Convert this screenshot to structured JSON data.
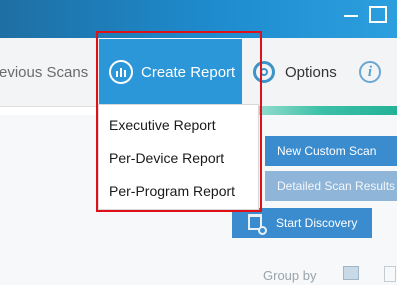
{
  "toolbar": {
    "previous_scans": "revious Scans",
    "create_report": "Create Report",
    "options": "Options",
    "info_glyph": "i"
  },
  "create_report_menu": {
    "items": [
      "Executive Report",
      "Per-Device Report",
      "Per-Program Report"
    ]
  },
  "actions": {
    "new_custom_scan": "New Custom Scan",
    "detailed_scan_results": "Detailed Scan Results",
    "start_discovery": "Start Discovery"
  },
  "footer": {
    "group_by": "Group by"
  },
  "icons": {
    "create_report": "report-chart-icon",
    "options": "gear-icon",
    "info": "info-icon",
    "start_discovery": "discovery-icon",
    "minimize": "minimize-icon",
    "maximize": "maximize-icon"
  },
  "colors": {
    "title_bar": "#1e8ccf",
    "create_report_bg": "#2b96d8",
    "action_button": "#3a8ccf",
    "action_button_disabled": "#8fb5d8",
    "accent": "#3cc0a7",
    "highlight": "#e01018"
  }
}
